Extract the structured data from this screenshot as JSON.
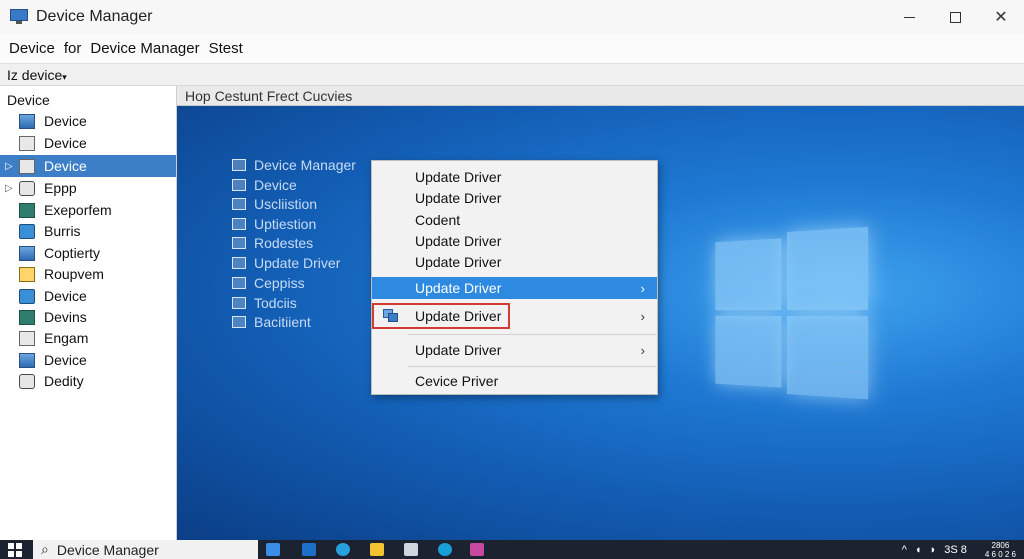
{
  "window": {
    "title": "Device Manager",
    "app_icon": "monitor-icon",
    "controls": [
      "minimize-icon",
      "maximize-icon",
      "close-icon"
    ]
  },
  "menubar": {
    "items": [
      "Device",
      "for",
      "Device Manager",
      "Stest"
    ]
  },
  "toolbar": {
    "dropdown_label": "Iz device"
  },
  "tree": {
    "root": "Device",
    "items": [
      {
        "label": "Device",
        "icon": "network-icon"
      },
      {
        "label": "Device",
        "icon": "printer-icon"
      },
      {
        "label": "Device",
        "icon": "device-icon",
        "selected": true
      },
      {
        "label": "Eppp",
        "icon": "folder-icon"
      },
      {
        "label": "Exeporfem",
        "icon": "monitor-icon"
      },
      {
        "label": "Burris",
        "icon": "battery-icon"
      },
      {
        "label": "Coptierty",
        "icon": "disk-icon"
      },
      {
        "label": "Roupvem",
        "icon": "folder-icon"
      },
      {
        "label": "Device",
        "icon": "monitor-icon"
      },
      {
        "label": "Devins",
        "icon": "keyboard-icon"
      },
      {
        "label": "Engam",
        "icon": "drive-icon"
      },
      {
        "label": "Device",
        "icon": "display-icon"
      },
      {
        "label": "Dedity",
        "icon": "document-icon"
      }
    ]
  },
  "content": {
    "header": "Hop Cestunt Frect Cucvies",
    "background_list": [
      "Device Manager",
      "Device",
      "Uscliistion",
      "Uptiestion",
      "Rodestes",
      "Update Driver",
      "Ceppiss",
      "Todciis",
      "Bacitiient"
    ]
  },
  "context_menu": {
    "items": [
      {
        "label": "Update Driver"
      },
      {
        "label": "Update Driver"
      },
      {
        "label": "Codent"
      },
      {
        "label": "Update Driver"
      },
      {
        "label": "Update Driver"
      },
      {
        "label": "Update Driver",
        "highlighted": true,
        "submenu": true
      },
      {
        "label": "Update Driver",
        "boxed": true,
        "submenu": true,
        "icon": "driver-icon"
      },
      {
        "label": "Update Driver",
        "submenu": true
      },
      {
        "label": "Cevice Priver"
      }
    ],
    "accent_color": "#2d8ae0",
    "box_color": "#d33a32"
  },
  "taskbar": {
    "search_text": "Device Manager",
    "tray_text": "3S 8",
    "clock_line1": "2806",
    "clock_line2": "4 6 0 2 6"
  }
}
